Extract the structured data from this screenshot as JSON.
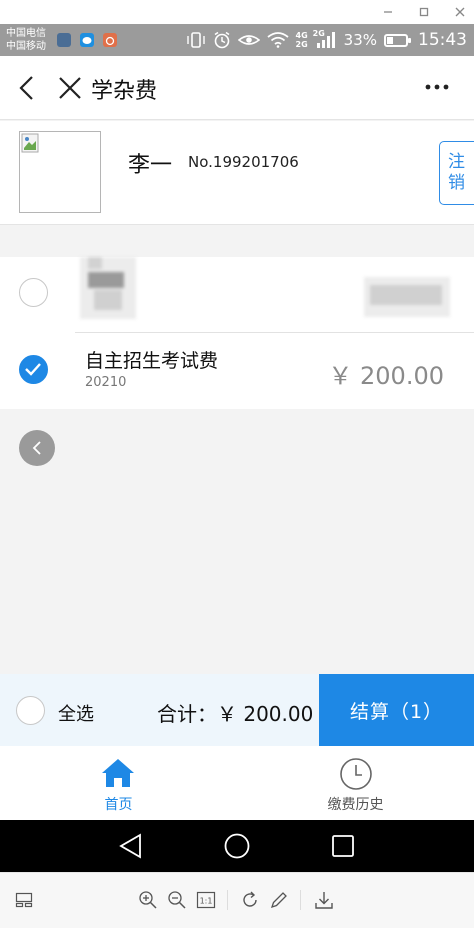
{
  "status_bar": {
    "carrier_1": "中国电信",
    "carrier_2": "中国移动",
    "net_top": "4G",
    "net_bottom": "2G",
    "net_2": "2G",
    "battery_percent": "33%",
    "battery_level": 0.33,
    "time": "15:43"
  },
  "header": {
    "title": "学杂费",
    "back_icon": "chevron-left-icon",
    "close_icon": "close-icon",
    "more_icon": "more-dots-icon"
  },
  "profile": {
    "name": "李一",
    "student_no": "No.199201706",
    "logout_label_1": "注",
    "logout_label_2": "销"
  },
  "fees": [
    {
      "name": "",
      "code": "",
      "amount": "",
      "checked": false,
      "redacted": true
    },
    {
      "name": "自主招生考试费",
      "code": "20210",
      "amount": "￥ 200.00",
      "checked": true,
      "redacted": false
    }
  ],
  "checkout": {
    "select_all": "全选",
    "total": "合计：￥ 200.00",
    "pay_button": "结算（1）"
  },
  "tabs": [
    {
      "label": "首页",
      "icon": "home-icon",
      "active": true
    },
    {
      "label": "缴费历史",
      "icon": "clock-icon",
      "active": false
    }
  ],
  "colors": {
    "accent": "#1e88e5",
    "tab_active": "#1e88e5",
    "tab_inactive": "#555555",
    "amount_gray": "#8a8a8a",
    "checkout_bg": "#eef6fc"
  }
}
